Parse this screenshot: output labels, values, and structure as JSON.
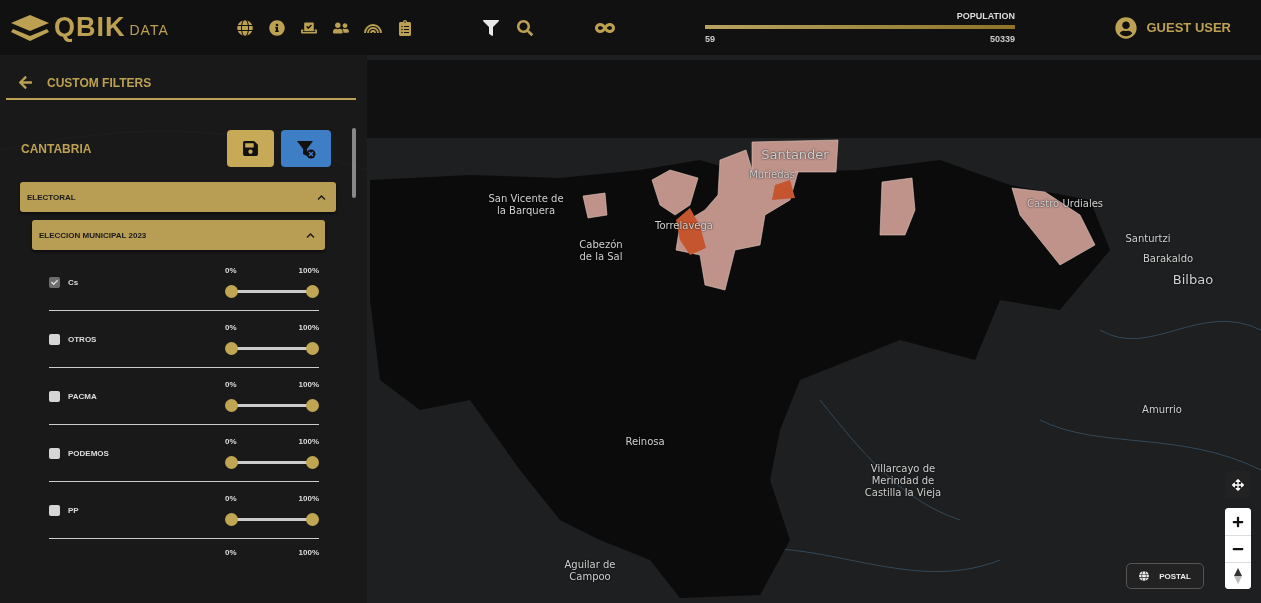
{
  "header": {
    "logo": {
      "word": "QBIK",
      "sub": "DATA"
    },
    "nav_icons": [
      {
        "kind": "globe",
        "selected": false
      },
      {
        "kind": "info",
        "selected": false
      },
      {
        "kind": "ballot",
        "selected": false
      },
      {
        "kind": "people",
        "selected": false
      },
      {
        "kind": "rainbow",
        "selected": false
      },
      {
        "kind": "clipboard",
        "selected": false
      }
    ],
    "tool_icons": [
      {
        "kind": "filter",
        "selected": true
      },
      {
        "kind": "search",
        "selected": false
      },
      {
        "kind": "infinity",
        "selected": false
      }
    ],
    "population": {
      "label": "POPULATION",
      "min": "59",
      "max": "50339",
      "level": 1
    },
    "user": "GUEST USER"
  },
  "sidebar": {
    "title": "CUSTOM FILTERS",
    "region": "CANTABRIA",
    "sections": [
      {
        "title": "ELECTORAL",
        "expanded": true,
        "children": [
          {
            "title": "ELECCION MUNICIPAL 2023",
            "expanded": true,
            "filters": [
              {
                "kind": "party",
                "name": "Cs",
                "checked": true,
                "min_label": "0%",
                "max_label": "100%",
                "level": 1
              },
              {
                "kind": "party",
                "name": "OTROS",
                "checked": false,
                "min_label": "0%",
                "max_label": "100%",
                "level": 1
              },
              {
                "kind": "party",
                "name": "PACMA",
                "checked": false,
                "min_label": "0%",
                "max_label": "100%",
                "level": 1
              },
              {
                "kind": "party",
                "name": "PODEMOS",
                "checked": false,
                "min_label": "0%",
                "max_label": "100%",
                "level": 1
              },
              {
                "kind": "party",
                "name": "PP",
                "checked": false,
                "min_label": "0%",
                "max_label": "100%",
                "level": 1
              },
              {
                "kind": "cut",
                "min_label": "0%",
                "max_label": "100%"
              }
            ]
          }
        ]
      }
    ]
  },
  "map": {
    "labels": [
      {
        "text": "Santander",
        "kind": "city"
      },
      {
        "text": "Muriedas",
        "kind": "town"
      },
      {
        "text": "San Vicente de\nla Barquera",
        "kind": "town"
      },
      {
        "text": "Torrelavega",
        "kind": "town"
      },
      {
        "text": "Cabezón\nde la Sal",
        "kind": "town"
      },
      {
        "text": "Castro Urdiales",
        "kind": "town"
      },
      {
        "text": "Santurtzi",
        "kind": "town"
      },
      {
        "text": "Barakaldo",
        "kind": "town"
      },
      {
        "text": "Bilbao",
        "kind": "city"
      },
      {
        "text": "Amurrio",
        "kind": "town"
      },
      {
        "text": "Reinosa",
        "kind": "town"
      },
      {
        "text": "Villarcayo de\nMerindad de\nCastilla la Vieja",
        "kind": "town"
      },
      {
        "text": "Aguilar de\nCampoo",
        "kind": "town"
      }
    ],
    "layer_button": "POSTAL"
  }
}
